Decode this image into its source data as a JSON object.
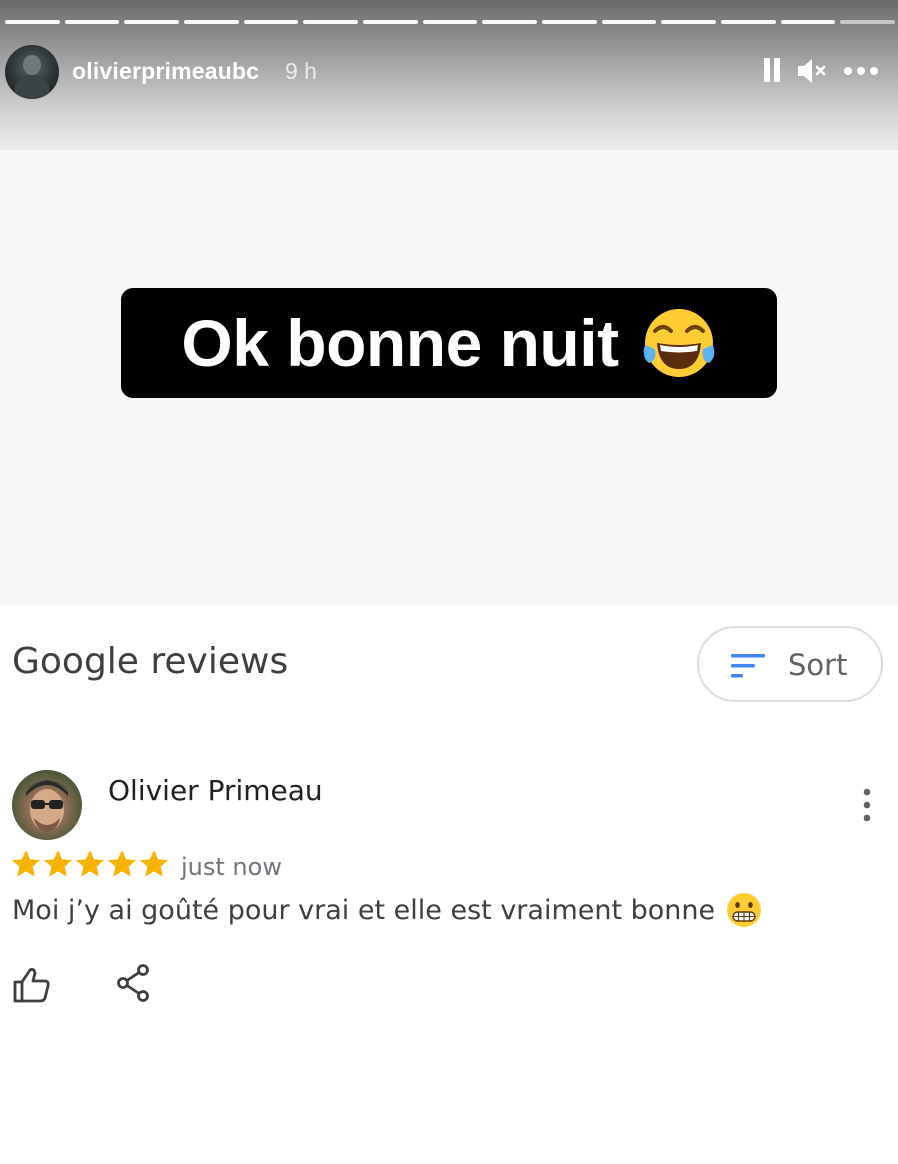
{
  "story": {
    "segment_count": 15,
    "username": "olivierprimeaubc",
    "time_ago": "9 h",
    "icons": [
      "pause-icon",
      "mute-icon",
      "more-options-icon"
    ],
    "caption": "Ok bonne nuit",
    "caption_emoji": "face-with-tears-of-joy"
  },
  "reviews": {
    "title": "Google reviews",
    "sort_label": "Sort",
    "items": [
      {
        "author": "Olivier Primeau",
        "rating": 5,
        "rating_max": 5,
        "time": "just now",
        "text": "Moi j’y ai goûté pour vrai et elle est vraiment bonne",
        "text_emoji": "grimacing-face"
      }
    ]
  },
  "colors": {
    "accent_blue": "#4285F4",
    "star_gold": "#F4B400",
    "caption_bg": "#000000"
  }
}
